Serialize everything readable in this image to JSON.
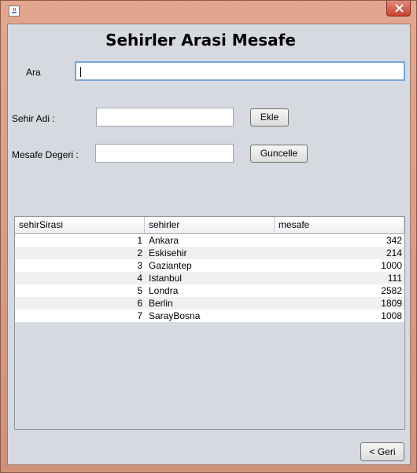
{
  "window": {
    "close_symbol": "✕"
  },
  "form": {
    "title": "Sehirler Arasi Mesafe",
    "search_label": "Ara",
    "search_value": "",
    "city_label": "Sehir Adi :",
    "city_value": "",
    "add_button": "Ekle",
    "distance_label": "Mesafe Degeri :",
    "distance_value": "",
    "update_button": "Guncelle",
    "back_button": "< Geri"
  },
  "table": {
    "columns": [
      "sehirSirasi",
      "sehirler",
      "mesafe"
    ],
    "rows": [
      [
        "1",
        "Ankara",
        "342"
      ],
      [
        "2",
        "Eskisehir",
        "214"
      ],
      [
        "3",
        "Gaziantep",
        "1000"
      ],
      [
        "4",
        "Istanbul",
        "111"
      ],
      [
        "5",
        "Londra",
        "2582"
      ],
      [
        "6",
        "Berlin",
        "1809"
      ],
      [
        "7",
        "SarayBosna",
        "1008"
      ]
    ]
  }
}
